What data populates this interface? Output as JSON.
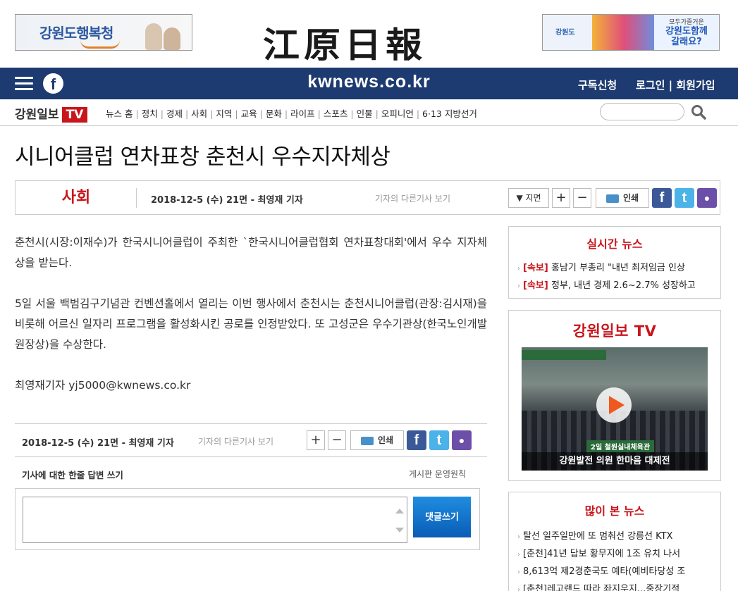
{
  "header": {
    "ad_left_text": "강원도행복청",
    "logo": "江原日報",
    "ad_right_org": "강원도",
    "ad_right_small": "모두가즐거운",
    "ad_right_big1": "강원도함께",
    "ad_right_big2": "갈래요?"
  },
  "navbar": {
    "domain": "kwnews.co.kr",
    "subscribe": "구독신청",
    "login": "로그인",
    "signup": "회원가입"
  },
  "subnav": {
    "brand": "강원일보",
    "brand_tv": "TV",
    "categories": [
      "뉴스 홈",
      "정치",
      "경제",
      "사회",
      "지역",
      "교육",
      "문화",
      "라이프",
      "스포츠",
      "인물",
      "오피니언",
      "6·13 지방선거"
    ]
  },
  "article": {
    "headline": "시니어클럽 연차표창 춘천시 우수지자체상",
    "section": "사회",
    "meta": "2018-12-5 (수) 21면 - 최영재 기자",
    "other_articles": "기자의 다른기사 보기",
    "page_btn": "▼ 지면",
    "print": "인쇄",
    "paragraphs": [
      "춘천시(시장:이재수)가 한국시니어클럽이 주최한 `한국시니어클럽협회 연차표창대회'에서 우수 지자체상을 받는다.",
      "5일 서울 백범김구기념관 컨벤션홀에서 열리는 이번 행사에서 춘천시는 춘천시니어클럽(관장:김시재)을 비롯해 어르신 일자리 프로그램을 활성화시킨 공로를 인정받았다. 또 고성군은 우수기관상(한국노인개발원장상)을 수상한다.",
      "최영재기자 yj5000@kwnews.co.kr"
    ]
  },
  "comments": {
    "heading": "기사에 대한 한줄 답변 쓰기",
    "rules": "게시판 운영원칙",
    "submit": "댓글쓰기"
  },
  "sidebar": {
    "realtime_title": "실시간 뉴스",
    "realtime": [
      {
        "tag": "[속보]",
        "text": "홍남기 부총리 \"내년 최저임금 인상"
      },
      {
        "tag": "[속보]",
        "text": "정부, 내년 경제 2.6~2.7% 성장하고"
      }
    ],
    "tv_title": "강원일보 TV",
    "video_venue": "2일 철원실내체육관",
    "video_caption": "강원발전 의원 한마음 대제전",
    "popular_title": "많이 본 뉴스",
    "popular": [
      "탈선 일주일만에 또 멈춰선 강릉선 KTX",
      "[춘천]41년 답보 황무지에 1조 유치 나서",
      "8,613억 제2경춘국도 예타(예비타당성 조",
      "[춘천]레고랜드 따라 좌지우지...중장기적"
    ]
  },
  "colors": {
    "navbar": "#1d3b70",
    "accent_red": "#c8161d",
    "submit_blue": "#0a5cb5"
  }
}
